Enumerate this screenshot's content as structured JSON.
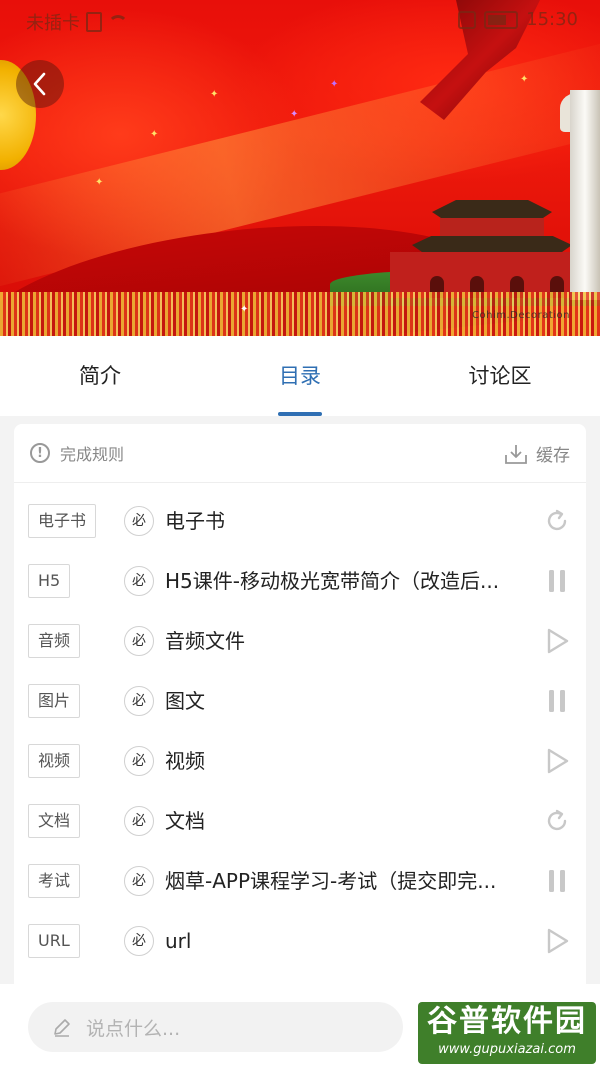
{
  "status_bar": {
    "carrier": "未插卡",
    "time": "15:30"
  },
  "banner": {
    "watermark": "Cohim.Decoration"
  },
  "tabs": [
    {
      "label": "简介",
      "active": false
    },
    {
      "label": "目录",
      "active": true
    },
    {
      "label": "讨论区",
      "active": false
    }
  ],
  "toolbar": {
    "rules_label": "完成规则",
    "cache_label": "缓存"
  },
  "required_marker": "必",
  "items": [
    {
      "type": "电子书",
      "title": "电子书",
      "status_icon": "refresh-icon"
    },
    {
      "type": "H5",
      "title": "H5课件-移动极光宽带简介（改造后...",
      "status_icon": "pause-icon"
    },
    {
      "type": "音频",
      "title": "音频文件",
      "status_icon": "play-icon"
    },
    {
      "type": "图片",
      "title": "图文",
      "status_icon": "pause-icon"
    },
    {
      "type": "视频",
      "title": "视频",
      "status_icon": "play-icon"
    },
    {
      "type": "文档",
      "title": "文档",
      "status_icon": "refresh-icon"
    },
    {
      "type": "考试",
      "title": "烟草-APP课程学习-考试（提交即完...",
      "status_icon": "pause-icon"
    },
    {
      "type": "URL",
      "title": "url",
      "status_icon": "play-icon"
    }
  ],
  "comment": {
    "placeholder": "说点什么..."
  },
  "site_watermark": {
    "name": "谷普软件园",
    "url": "www.gupuxiazai.com"
  },
  "colors": {
    "accent": "#2f6fb3",
    "icon_gray": "#c8c8c8"
  }
}
